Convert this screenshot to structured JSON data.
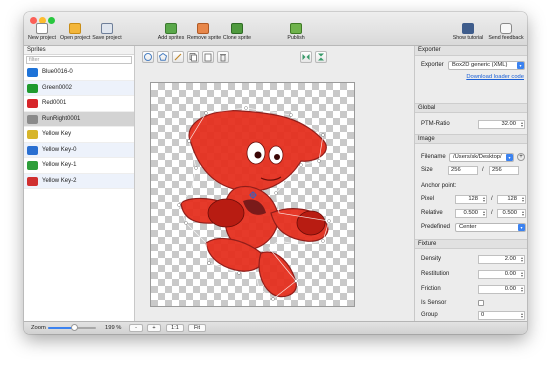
{
  "toolbar": {
    "new_project": "New project",
    "open_project": "Open project",
    "save_project": "Save project",
    "add_sprites": "Add sprites",
    "remove_sprite": "Remove sprite",
    "clone_sprite": "Clone sprite",
    "publish": "Publish",
    "show_tutorial": "Show tutorial",
    "send_feedback": "Send feedback"
  },
  "sidebar": {
    "title": "Sprites",
    "filter_placeholder": "filter",
    "items": [
      {
        "label": "Blue0016-0",
        "thumb_color": "#1e73d8"
      },
      {
        "label": "Green0002",
        "thumb_color": "#1f9a2e"
      },
      {
        "label": "Red0001",
        "thumb_color": "#d7262b"
      },
      {
        "label": "RunRight0001",
        "thumb_color": "#8a8a8a"
      },
      {
        "label": "Yellow Key",
        "thumb_color": "#d7b52a"
      },
      {
        "label": "Yellow Key-0",
        "thumb_color": "#2a6fd1"
      },
      {
        "label": "Yellow Key-1",
        "thumb_color": "#2e9e3a"
      },
      {
        "label": "Yellow Key-2",
        "thumb_color": "#d03030"
      }
    ]
  },
  "exporter": {
    "section_title": "Exporter",
    "exporter_label": "Exporter",
    "exporter_value": "Box2D generic (XML)",
    "download_link": "Download loader code"
  },
  "global": {
    "section_title": "Global",
    "ptm_label": "PTM-Ratio",
    "ptm_value": "32.00"
  },
  "image": {
    "section_title": "Image",
    "filename_label": "Filename",
    "filename_value": "/Users/sk/Desktop/",
    "size_label": "Size",
    "size_w": "256",
    "size_sep": "/",
    "size_h": "256",
    "anchor_title": "Anchor point:",
    "pixel_label": "Pixel",
    "pixel_x": "128",
    "pixel_y": "128",
    "relative_label": "Relative",
    "relative_x": "0.500",
    "relative_y": "0.500",
    "predefined_label": "Predefined",
    "predefined_value": "Center"
  },
  "fixture": {
    "section_title": "Fixture",
    "density_label": "Density",
    "density_value": "2.00",
    "restitution_label": "Restitution",
    "restitution_value": "0.00",
    "friction_label": "Friction",
    "friction_value": "0.00",
    "sensor_label": "Is Sensor",
    "group_label": "Group",
    "group_value": "0"
  },
  "statusbar": {
    "zoom_label": "Zoom",
    "zoom_value": "199 %",
    "zoom_fraction": 0.55,
    "minus": "-",
    "plus": "+",
    "one_to_one": "1:1",
    "fit": "Fit"
  },
  "colors": {
    "accent_blue": "#3b82f0",
    "link_blue": "#1a5fd6",
    "sprite_red": "#e5301f",
    "selection_gray": "#d3d3d3"
  }
}
